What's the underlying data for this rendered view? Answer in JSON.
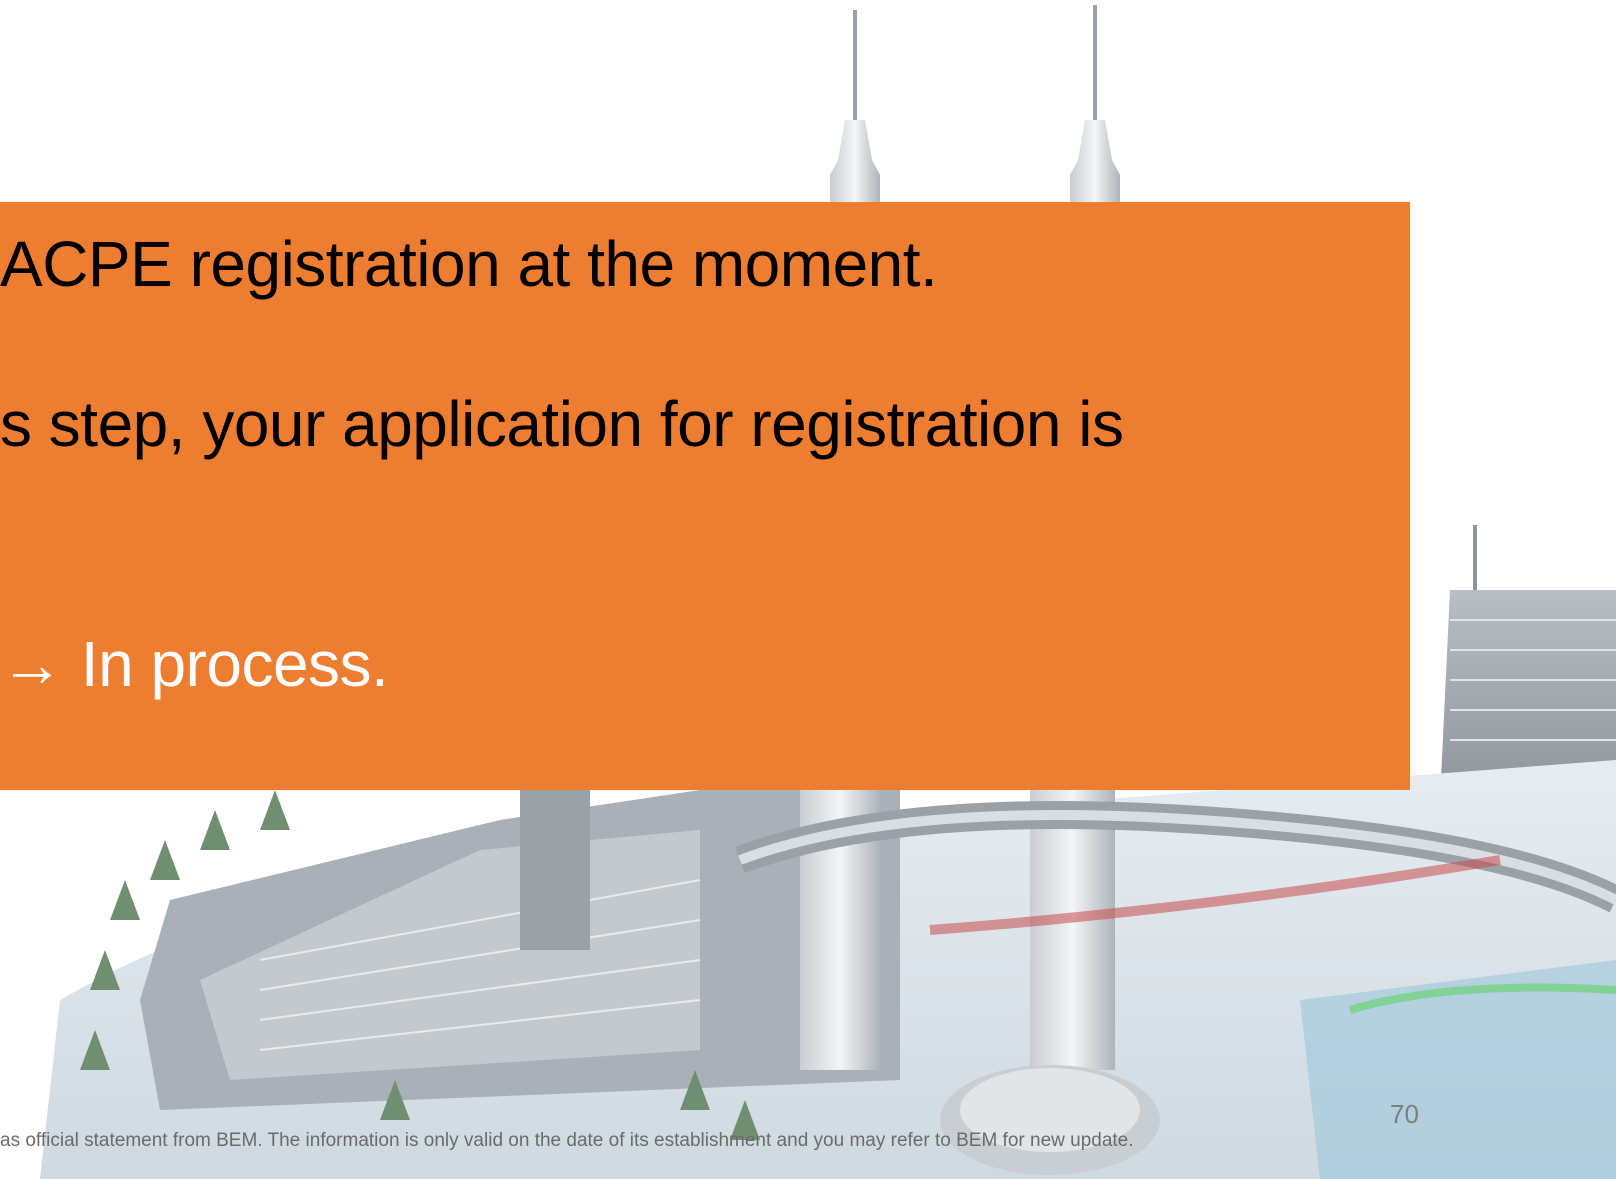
{
  "slide": {
    "lines": [
      "ACPE registration at the moment.",
      "s step, your application for registration is",
      "→ In process."
    ],
    "page_number": "70",
    "disclaimer": " as official statement from BEM. The information is only valid on the date of its establishment and you may refer to BEM for new update."
  },
  "colors": {
    "callout_background": "#ED7D31",
    "text_dark": "#000000",
    "text_light": "#FFFFFF",
    "footer_text": "#6B6B6B"
  },
  "background_image": "futuristic-city-illustration"
}
